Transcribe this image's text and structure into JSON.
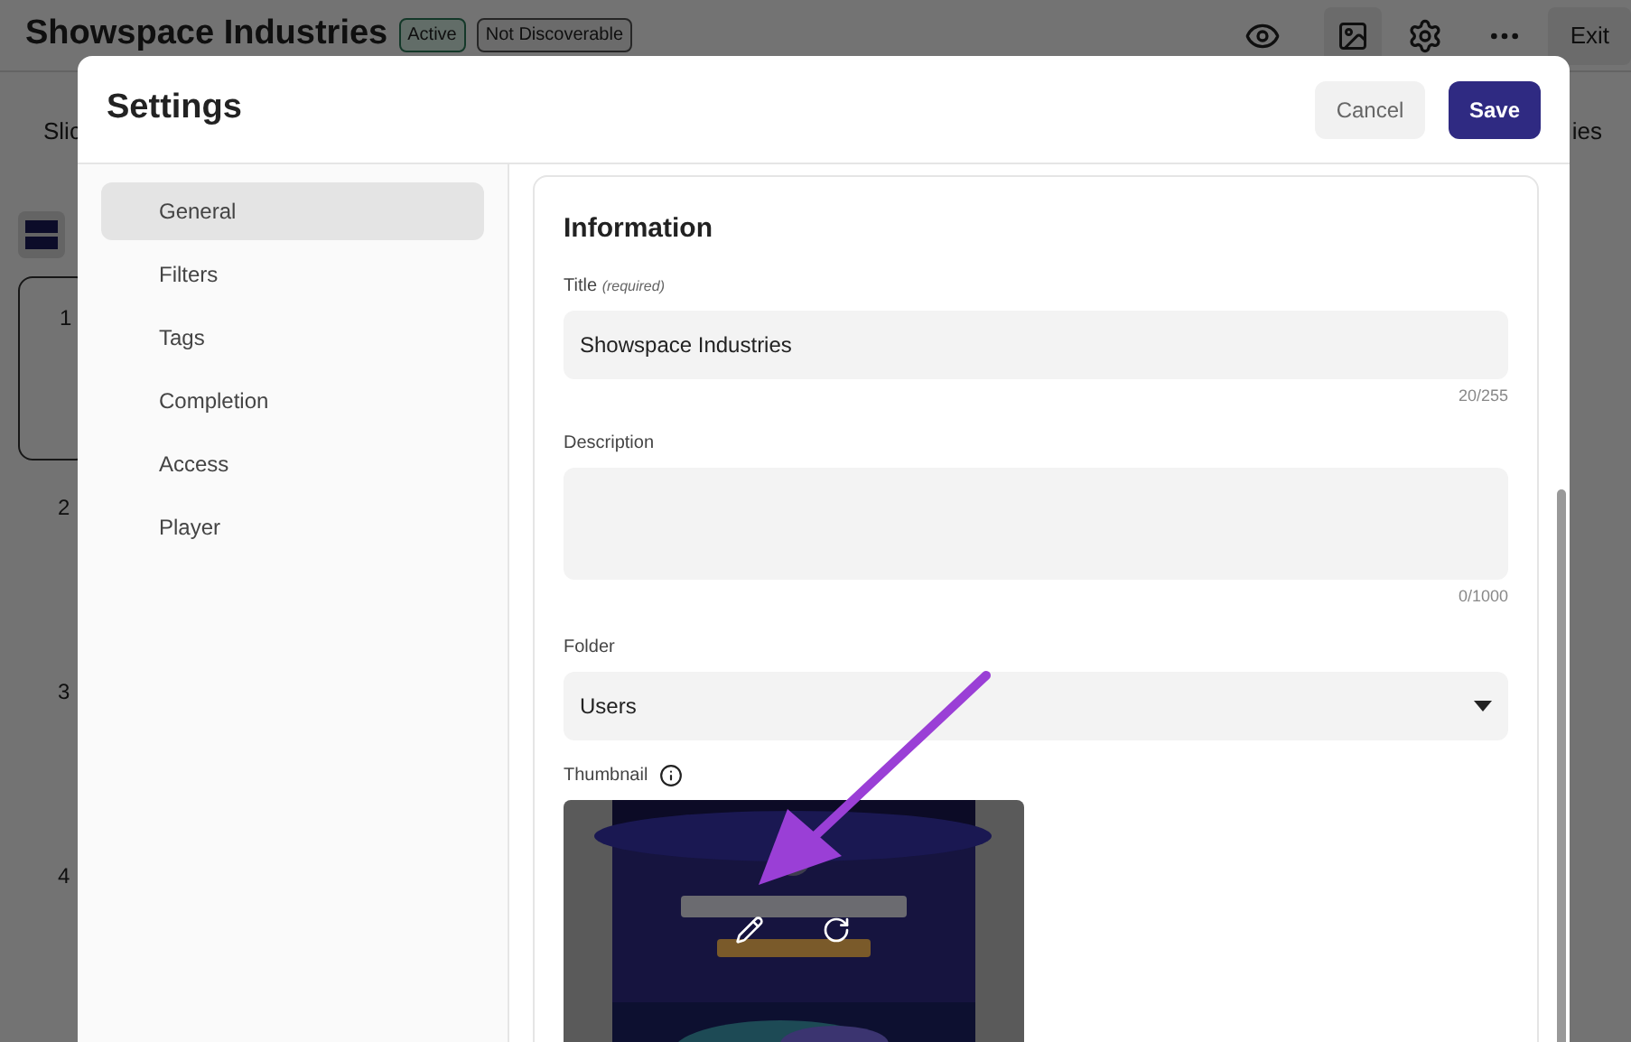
{
  "app": {
    "title": "Showspace Industries",
    "badges": [
      "Active",
      "Not Discoverable"
    ],
    "exit_label": "Exit",
    "tab_left": "Slic",
    "tab_right": "ies",
    "slide_numbers": [
      "1",
      "2",
      "3",
      "4"
    ]
  },
  "dialog": {
    "title": "Settings",
    "cancel": "Cancel",
    "save": "Save",
    "nav": [
      {
        "label": "General",
        "selected": true
      },
      {
        "label": "Filters",
        "selected": false
      },
      {
        "label": "Tags",
        "selected": false
      },
      {
        "label": "Completion",
        "selected": false
      },
      {
        "label": "Access",
        "selected": false
      },
      {
        "label": "Player",
        "selected": false
      }
    ],
    "section_title": "Information",
    "title_field": {
      "label": "Title",
      "hint": "(required)",
      "value": "Showspace Industries",
      "counter": "20/255"
    },
    "description_field": {
      "label": "Description",
      "counter": "0/1000"
    },
    "folder_field": {
      "label": "Folder",
      "value": "Users"
    },
    "thumbnail": {
      "label": "Thumbnail",
      "kind": "picture"
    }
  }
}
